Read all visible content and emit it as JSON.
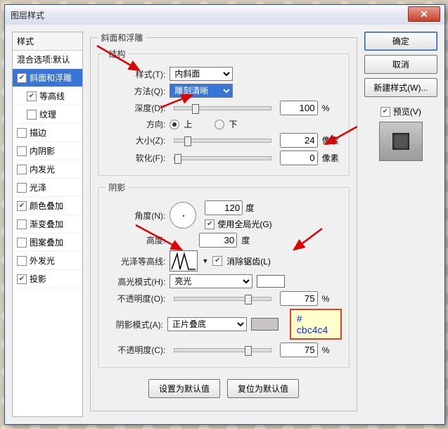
{
  "window": {
    "title": "图层样式"
  },
  "styles": {
    "header": "样式",
    "blend": "混合选项:默认",
    "items": [
      {
        "label": "斜面和浮雕",
        "checked": true,
        "selected": true
      },
      {
        "label": "等高线",
        "checked": true,
        "indent": true
      },
      {
        "label": "纹理",
        "checked": false,
        "indent": true
      },
      {
        "label": "描边",
        "checked": false
      },
      {
        "label": "内阴影",
        "checked": false
      },
      {
        "label": "内发光",
        "checked": false
      },
      {
        "label": "光泽",
        "checked": false
      },
      {
        "label": "颜色叠加",
        "checked": true
      },
      {
        "label": "渐变叠加",
        "checked": false
      },
      {
        "label": "图案叠加",
        "checked": false
      },
      {
        "label": "外发光",
        "checked": false
      },
      {
        "label": "投影",
        "checked": true
      }
    ]
  },
  "bevel": {
    "group": "斜面和浮雕",
    "structure": "结构",
    "style_l": "样式(T):",
    "style_v": "内斜面",
    "tech_l": "方法(Q):",
    "tech_v": "雕刻清晰",
    "depth_l": "深度(D):",
    "depth_v": "100",
    "depth_u": "%",
    "dir_l": "方向:",
    "up": "上",
    "down": "下",
    "size_l": "大小(Z):",
    "size_v": "24",
    "size_u": "像素",
    "soft_l": "软化(F):",
    "soft_v": "0",
    "soft_u": "像素"
  },
  "shading": {
    "group": "阴影",
    "angle_l": "角度(N):",
    "angle_v": "120",
    "deg": "度",
    "global": "使用全局光(G)",
    "alt_l": "高度:",
    "alt_v": "30",
    "gloss_l": "光泽等高线:",
    "aa": "消除锯齿(L)",
    "hl_l": "高光模式(H):",
    "hl_v": "亮光",
    "hlo_l": "不透明度(O):",
    "hlo_v": "75",
    "pct": "%",
    "sh_l": "阴影模式(A):",
    "sh_v": "正片叠底",
    "sho_l": "不透明度(C):",
    "sho_v": "75"
  },
  "buttons": {
    "ok": "确定",
    "cancel": "取消",
    "new": "新建样式(W)...",
    "preview": "预览(V)",
    "defaults": "设置为默认值",
    "reset": "复位为默认值"
  },
  "note": "# cbc4c4",
  "colors": {
    "shadow_swatch": "#cbc4c4"
  }
}
